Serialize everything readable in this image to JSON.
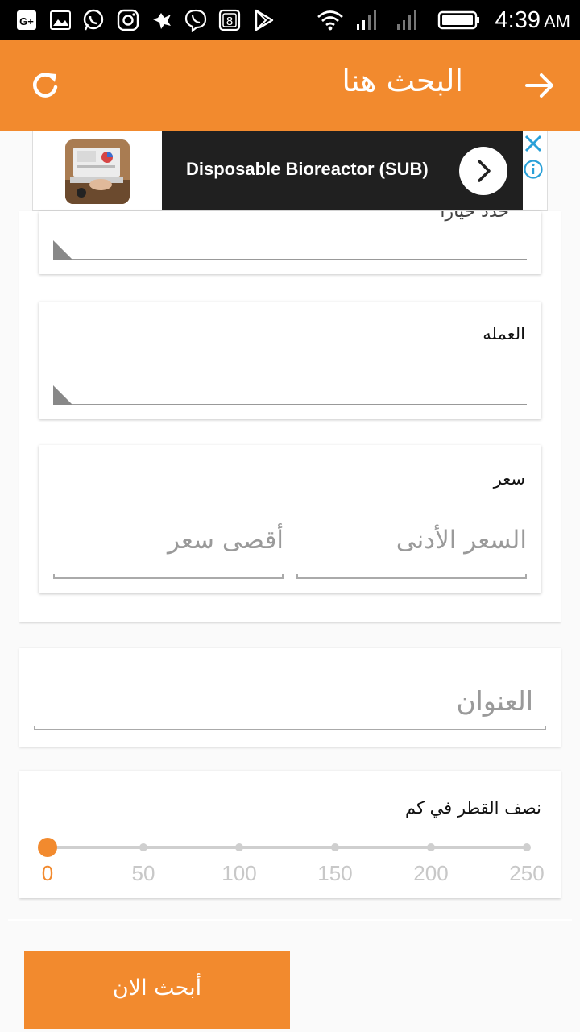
{
  "status_bar": {
    "time": "4:39",
    "ampm": "AM",
    "icons": [
      "google-plus-icon",
      "gallery-icon",
      "whatsapp-icon",
      "instagram-icon",
      "bug-icon",
      "viber-icon",
      "badge-8-icon",
      "play-store-icon",
      "wifi-icon",
      "signal-icon",
      "signal-icon",
      "battery-icon"
    ],
    "badge_number": "8"
  },
  "app_bar": {
    "title": "البحث هنا",
    "back_icon": "arrow-right-icon",
    "refresh_icon": "refresh-icon"
  },
  "ad": {
    "text": "Disposable Bioreactor (SUB)",
    "go_icon": "chevron-right-icon",
    "close_icon": "close-icon",
    "info_icon": "info-icon",
    "accent": "#29a0d8"
  },
  "filters": {
    "partial_label": "حدد خيارا",
    "currency_label": "العمله",
    "price_label": "سعر",
    "price_min_placeholder": "السعر الأدنى",
    "price_max_placeholder": "أقصى سعر",
    "address_placeholder": "العنوان",
    "radius_label": "نصف القطر في كم",
    "radius_ticks": [
      "0",
      "50",
      "100",
      "150",
      "200",
      "250"
    ],
    "radius_value": "0"
  },
  "search_button": {
    "label": "أبحث الان"
  },
  "colors": {
    "accent": "#f28a2e",
    "status_bar": "#000000",
    "background": "#fafafa"
  }
}
